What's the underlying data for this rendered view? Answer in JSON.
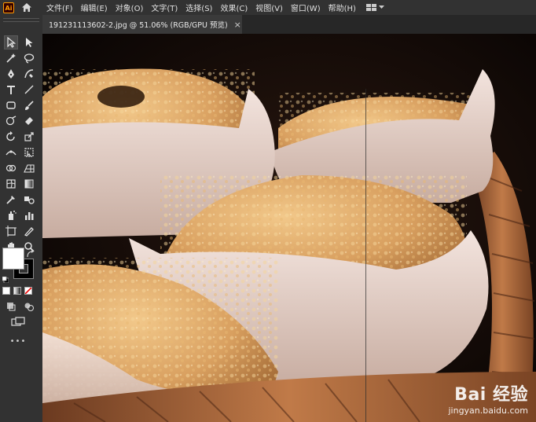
{
  "app": {
    "logo_text": "Ai"
  },
  "menu": {
    "items": [
      "文件(F)",
      "编辑(E)",
      "对象(O)",
      "文字(T)",
      "选择(S)",
      "效果(C)",
      "视图(V)",
      "窗口(W)",
      "帮助(H)"
    ]
  },
  "document": {
    "tab_title": "191231113602-2.jpg @ 51.06% (RGB/GPU 预览)",
    "close_glyph": "×"
  },
  "colors": {
    "accent": "#ff9a00",
    "ui_bg": "#323232",
    "fill": "#ffffff",
    "stroke": "#000000"
  },
  "watermark": {
    "logo": "Bai 经验",
    "url": "jingyan.baidu.com"
  },
  "toolbar": {
    "icons": [
      "selection-tool-icon",
      "direct-selection-tool-icon",
      "magic-wand-tool-icon",
      "lasso-tool-icon",
      "pen-tool-icon",
      "curvature-tool-icon",
      "type-tool-icon",
      "line-segment-tool-icon",
      "rectangle-tool-icon",
      "paintbrush-tool-icon",
      "shaper-tool-icon",
      "eraser-tool-icon",
      "rotate-tool-icon",
      "scale-tool-icon",
      "width-tool-icon",
      "free-transform-tool-icon",
      "shape-builder-tool-icon",
      "perspective-grid-tool-icon",
      "mesh-tool-icon",
      "gradient-tool-icon",
      "eyedropper-tool-icon",
      "blend-tool-icon",
      "symbol-sprayer-tool-icon",
      "column-graph-tool-icon",
      "artboard-tool-icon",
      "slice-tool-icon",
      "hand-tool-icon",
      "zoom-tool-icon"
    ],
    "more_label": "•••"
  }
}
